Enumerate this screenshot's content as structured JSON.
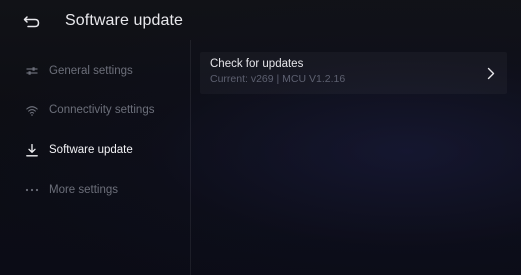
{
  "header": {
    "title": "Software update",
    "back_icon": "back-arrow-icon"
  },
  "sidebar": {
    "items": [
      {
        "label": "General settings",
        "icon": "sliders-icon",
        "active": false
      },
      {
        "label": "Connectivity settings",
        "icon": "wifi-icon",
        "active": false
      },
      {
        "label": "Software update",
        "icon": "download-icon",
        "active": true
      },
      {
        "label": "More settings",
        "icon": "more-dots-icon",
        "active": false
      }
    ]
  },
  "main": {
    "rows": [
      {
        "title": "Check for updates",
        "subtitle": "Current: v269 | MCU V1.2.16",
        "icon": "chevron-right-icon"
      }
    ]
  },
  "colors": {
    "background": "#0b0d14",
    "text_primary": "#e8e8ec",
    "text_muted": "#6c6f7a",
    "row_background": "#14161e"
  }
}
